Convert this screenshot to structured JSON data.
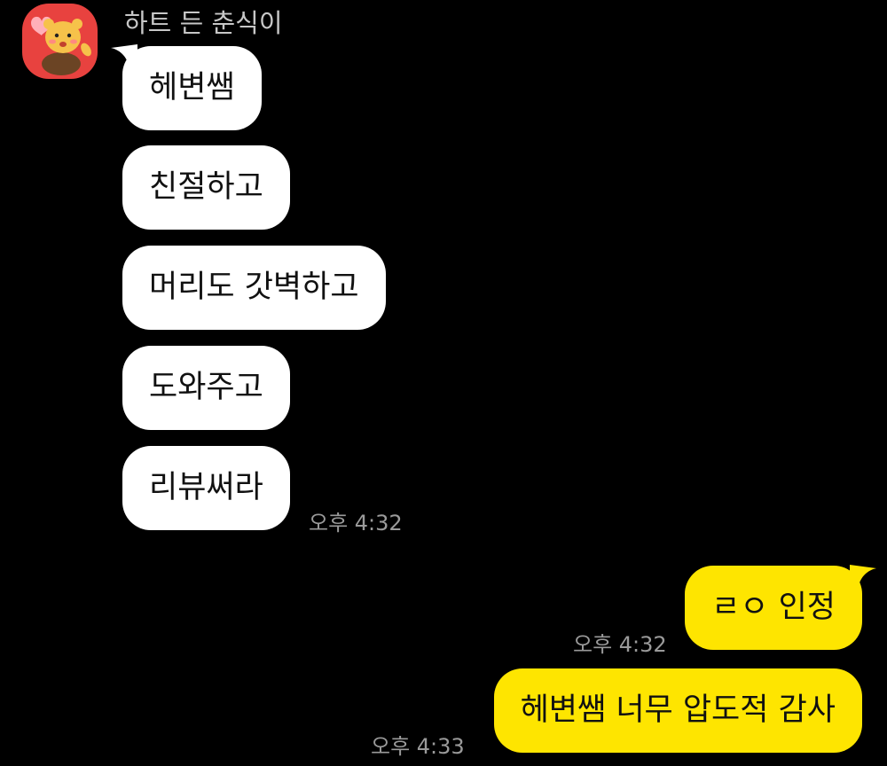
{
  "colors": {
    "background": "#000000",
    "incoming_bubble": "#ffffff",
    "outgoing_bubble": "#fee500",
    "avatar_bg": "#e8423f",
    "timestamp": "#9a9a9a"
  },
  "chat": {
    "sender": {
      "name": "하트 든 춘식이",
      "avatar_icon": "chunsik-character-avatar-icon"
    },
    "incoming": [
      {
        "text": "헤변쌤"
      },
      {
        "text": "친절하고"
      },
      {
        "text": "머리도 갓벽하고"
      },
      {
        "text": "도와주고"
      },
      {
        "text": "리뷰써라",
        "time": "오후 4:32"
      }
    ],
    "outgoing": [
      {
        "text": "ㄹㅇ 인정",
        "time": "오후 4:32"
      },
      {
        "text": "헤변쌤 너무 압도적 감사",
        "time": "오후 4:33"
      }
    ]
  }
}
